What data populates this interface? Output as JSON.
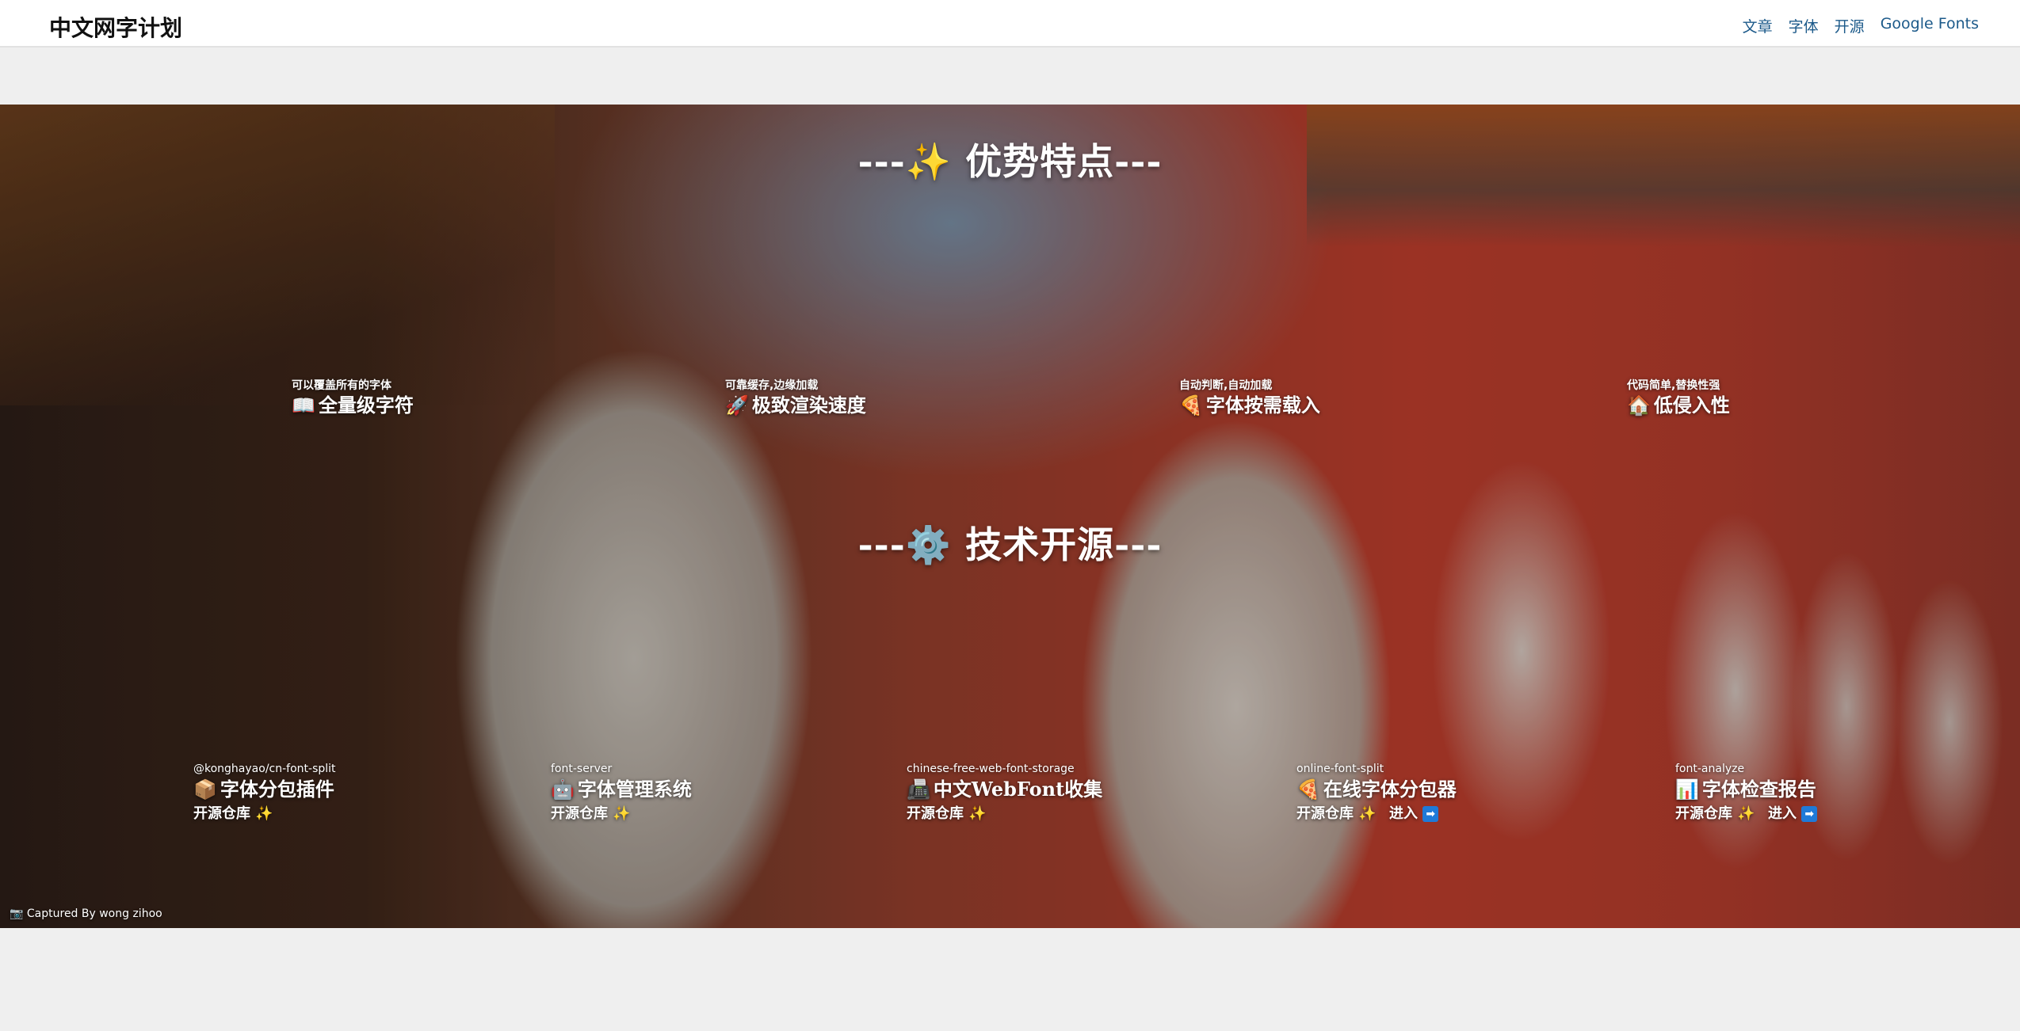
{
  "header": {
    "brand": "中文网字计划",
    "nav": [
      {
        "label": "文章"
      },
      {
        "label": "字体"
      },
      {
        "label": "开源"
      },
      {
        "label": "Google Fonts"
      }
    ]
  },
  "advantages": {
    "title": "---✨ 优势特点---",
    "items": [
      {
        "subtitle": "可以覆盖所有的字体",
        "icon": "📖",
        "icon_name": "book-icon",
        "title": "全量级字符"
      },
      {
        "subtitle": "可靠缓存,边缘加载",
        "icon": "🚀",
        "icon_name": "rocket-icon",
        "title": "极致渲染速度"
      },
      {
        "subtitle": "自动判断,自动加载",
        "icon": "🍕",
        "icon_name": "pizza-icon",
        "title": "字体按需载入"
      },
      {
        "subtitle": "代码简单,替换性强",
        "icon": "🏠",
        "icon_name": "house-icon",
        "title": "低侵入性"
      }
    ]
  },
  "opensource": {
    "title": "---⚙️ 技术开源---",
    "items": [
      {
        "subtitle": "@konghayao/cn-font-split",
        "icon": "📦",
        "icon_name": "package-icon",
        "title": "字体分包插件",
        "repo_label": "开源仓库",
        "spark": "✨",
        "enter_label": ""
      },
      {
        "subtitle": "font-server",
        "icon": "🤖",
        "icon_name": "robot-icon",
        "title": "字体管理系统",
        "repo_label": "开源仓库",
        "spark": "✨",
        "enter_label": ""
      },
      {
        "subtitle": "chinese-free-web-font-storage",
        "icon": "📠",
        "icon_name": "fax-icon",
        "title": "中文WebFont收集",
        "repo_label": "开源仓库",
        "spark": "✨",
        "enter_label": ""
      },
      {
        "subtitle": "online-font-split",
        "icon": "🍕",
        "icon_name": "pizza-icon",
        "title": "在线字体分包器",
        "repo_label": "开源仓库",
        "spark": "✨",
        "enter_label": "进入",
        "enter_icon": "➡"
      },
      {
        "subtitle": "font-analyze",
        "icon": "📊",
        "icon_name": "bar-chart-icon",
        "title": "字体检查报告",
        "repo_label": "开源仓库",
        "spark": "✨",
        "enter_label": "进入",
        "enter_icon": "➡"
      }
    ]
  },
  "credit": {
    "icon": "📷",
    "text": "Captured By wong zihoo"
  }
}
